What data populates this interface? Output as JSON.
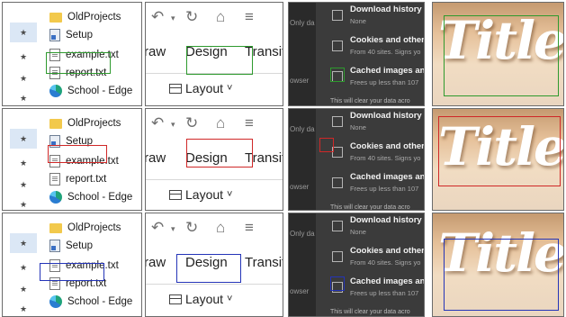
{
  "highlight_colors": {
    "green": "#2e9a2e",
    "red": "#d02828",
    "blue": "#2434b8"
  },
  "explorer": {
    "items": [
      {
        "label": "OldProjects",
        "icon": "folder-icon"
      },
      {
        "label": "Setup",
        "icon": "setup-file-icon"
      },
      {
        "label": "example.txt",
        "icon": "text-file-icon"
      },
      {
        "label": "report.txt",
        "icon": "text-file-icon"
      },
      {
        "label": "School - Edge",
        "icon": "edge-icon"
      }
    ]
  },
  "ribbon": {
    "tabs": [
      "raw",
      "Design",
      "Transit"
    ],
    "layout_label": "Layout",
    "icons": [
      "undo-icon",
      "redo-icon",
      "present-icon",
      "customize-icon"
    ]
  },
  "clear_data": {
    "left_fragment_top": "Only da",
    "left_fragment_bottom": "owser",
    "options": [
      {
        "title": "Download history",
        "subtitle": "None"
      },
      {
        "title": "Cookies and other",
        "subtitle": "From 40 sites. Signs yo"
      },
      {
        "title": "Cached images and",
        "subtitle": "Frees up less than 107"
      }
    ],
    "footer": "This will clear your data acro"
  },
  "image_panel": {
    "title_word": "Title"
  }
}
